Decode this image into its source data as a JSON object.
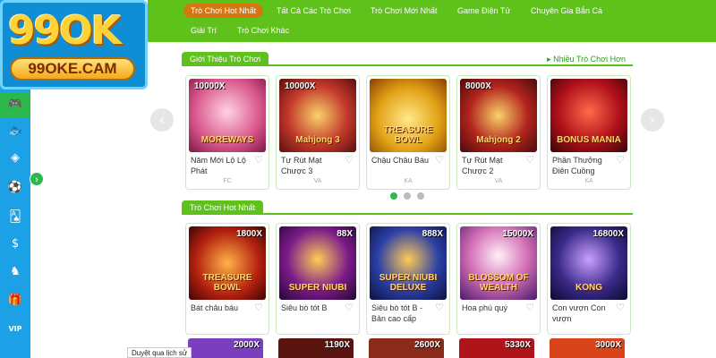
{
  "logo": {
    "main": "99OK",
    "url": "99OKE.CAM"
  },
  "nav": {
    "items": [
      {
        "label": "Trò Chơi Hot Nhất",
        "active": true
      },
      {
        "label": "Tất Cả Các Trò Chơi"
      },
      {
        "label": "Trò Chơi Mới Nhất"
      },
      {
        "label": "Game Điện Tử"
      },
      {
        "label": "Chuyên Gia Bắn Cá"
      },
      {
        "label": "Giải Trí"
      },
      {
        "label": "Trò Chơi Khác"
      }
    ]
  },
  "sidebar": {
    "icons": [
      "gamepad-icon",
      "fish-icon",
      "lottery-icon",
      "soccer-icon",
      "card-icon",
      "coin-icon",
      "horse-icon",
      "gift-icon",
      "vip-icon"
    ],
    "active_index": 0
  },
  "intro": {
    "tab": "Giới Thiệu Trò Chơi",
    "more": "Nhiều Trò Chơi Hơn",
    "cards": [
      {
        "name": "Năm Mới Lộ Lộ Phát",
        "provider": "FC",
        "title": "MOREWAYS",
        "mult": "10000X"
      },
      {
        "name": "Tự Rút Mạt Chược 3",
        "provider": "VA",
        "title": "Mahjong 3",
        "mult": "10000X"
      },
      {
        "name": "Chậu Châu Báu",
        "provider": "KA",
        "title": "TREASURE BOWL",
        "mult": ""
      },
      {
        "name": "Tự Rút Mạt Chược 2",
        "provider": "VA",
        "title": "Mahjong 2",
        "mult": "8000X"
      },
      {
        "name": "Phần Thưởng Điên Cuồng",
        "provider": "KA",
        "title": "BONUS MANIA",
        "mult": ""
      }
    ],
    "dots": 3,
    "active_dot": 0
  },
  "hot": {
    "tab": "Trò Chơi Hot Nhất",
    "cards": [
      {
        "name": "Bát châu báu",
        "title": "TREASURE BOWL",
        "mult": "1800X"
      },
      {
        "name": "Siêu bò tót B",
        "title": "SUPER NIUBI",
        "mult": "88X"
      },
      {
        "name": "Siêu bò tót B - Bản cao cấp",
        "title": "SUPER NIUBI DELUXE",
        "mult": "888X"
      },
      {
        "name": "Hoa phú quý",
        "title": "BLOSSOM OF WEALTH",
        "mult": "15000X"
      },
      {
        "name": "Con vượn Con vượn",
        "title": "KONG",
        "mult": "16800X"
      }
    ],
    "next_row_mults": [
      "2000X",
      "1190X",
      "2600X",
      "5330X",
      "3000X"
    ]
  },
  "tooltip": "Duyệt qua lịch sử",
  "colors": {
    "green": "#5ec21b",
    "blue": "#1da1e6",
    "orange": "#d67610"
  }
}
